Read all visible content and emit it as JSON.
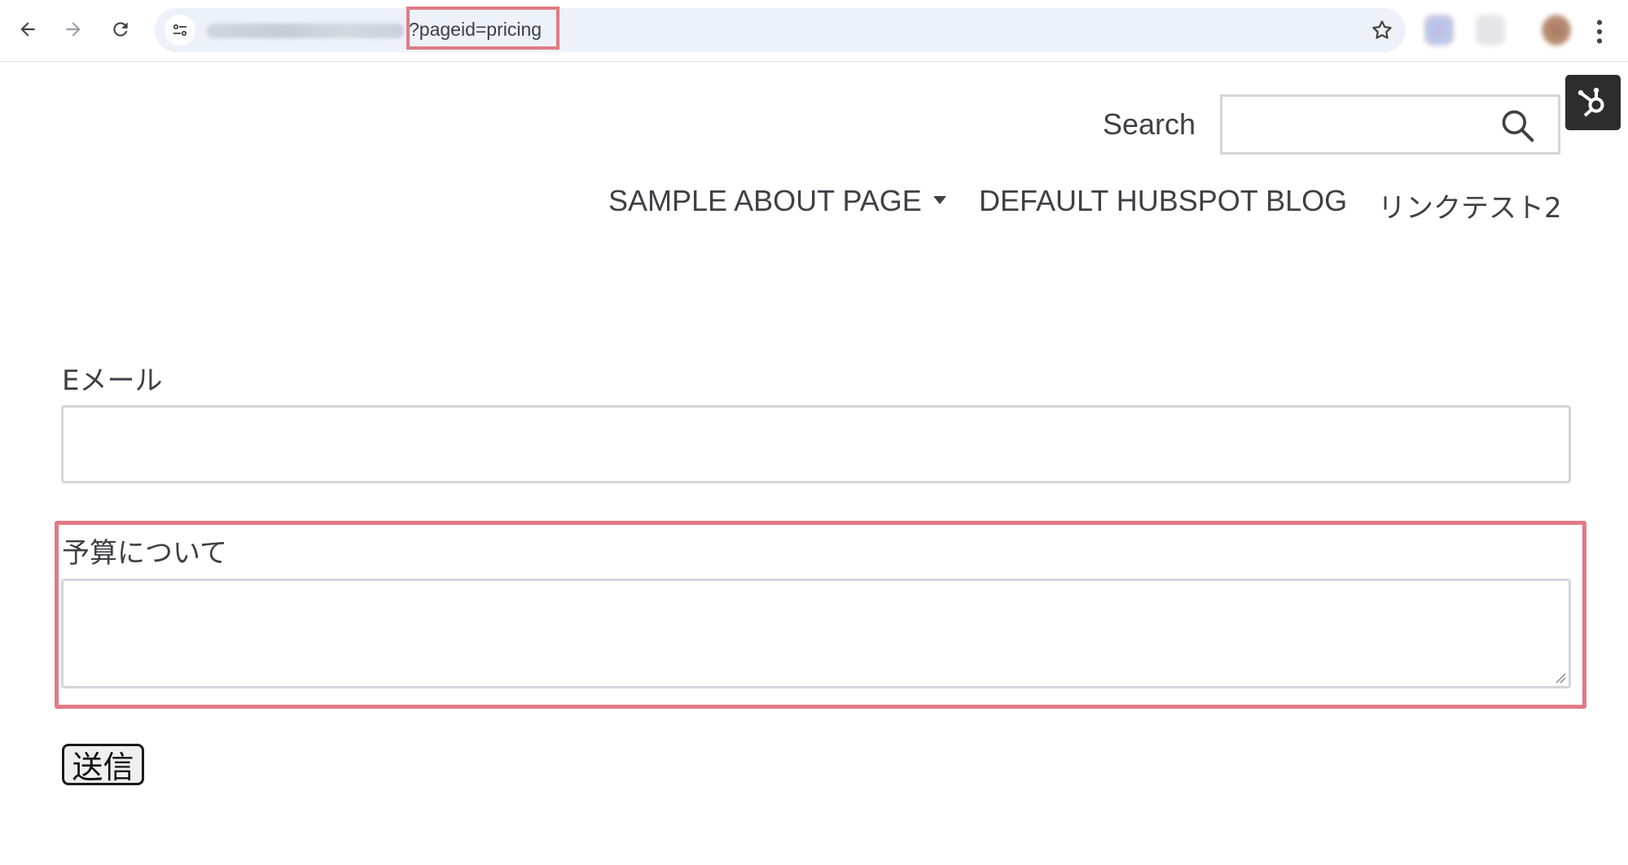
{
  "browser": {
    "url_visible": "?pageid=pricing",
    "icons": [
      "back-icon",
      "forward-icon",
      "reload-icon",
      "site-info-icon",
      "bookmark-star-icon",
      "menu-dots-icon"
    ],
    "highlight_color": "#e07a85"
  },
  "header": {
    "search_label": "Search",
    "search_value": "",
    "nav": [
      {
        "label": "SAMPLE ABOUT PAGE",
        "has_dropdown": true
      },
      {
        "label": "DEFAULT HUBSPOT BLOG"
      },
      {
        "label": "リンクテスト2"
      }
    ]
  },
  "form": {
    "email_label": "Eメール",
    "email_value": "",
    "budget_label": "予算について",
    "budget_value": "",
    "submit_label": "送信"
  }
}
